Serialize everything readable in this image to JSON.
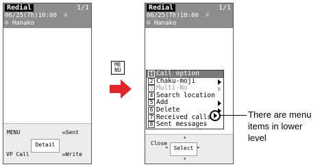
{
  "left_phone": {
    "header": {
      "title": "Redial",
      "count": "1/1",
      "datetime": "06/25(Th)10:00",
      "name": "Hanako"
    },
    "softkeys": {
      "menu": "MENU",
      "detail": "Detail",
      "sent": "Sent",
      "vp_call": "VP Call",
      "write": "Write"
    }
  },
  "menu_key_label": "ME NU",
  "right_phone": {
    "header": {
      "title": "Redial",
      "count": "1/1",
      "datetime": "06/25(Th)10:00",
      "name": "Hanako"
    },
    "menu": {
      "items": [
        {
          "num": "1",
          "label": "Call option",
          "state": "selected",
          "submenu": false
        },
        {
          "num": "2",
          "label": "Chaku-moji",
          "state": "normal",
          "submenu": true
        },
        {
          "num": "3",
          "label": "Multi-No",
          "state": "disabled",
          "submenu": true
        },
        {
          "num": "4",
          "label": "Search location",
          "state": "normal",
          "submenu": false
        },
        {
          "num": "5",
          "label": "Add",
          "state": "normal",
          "submenu": true
        },
        {
          "num": "6",
          "label": "Delete",
          "state": "normal",
          "submenu": true
        },
        {
          "num": "7",
          "label": "Received calls",
          "state": "normal",
          "submenu": false
        },
        {
          "num": "8",
          "label": "Sent messages",
          "state": "normal",
          "submenu": false
        }
      ]
    },
    "softkeys": {
      "close": "Close",
      "select": "Select"
    }
  },
  "callout": {
    "text": "There are menu items in lower level"
  },
  "colors": {
    "header_bg": "#8c8c8c",
    "selection_bg": "#7a7a7a",
    "arrow_red": "#e0262b"
  }
}
